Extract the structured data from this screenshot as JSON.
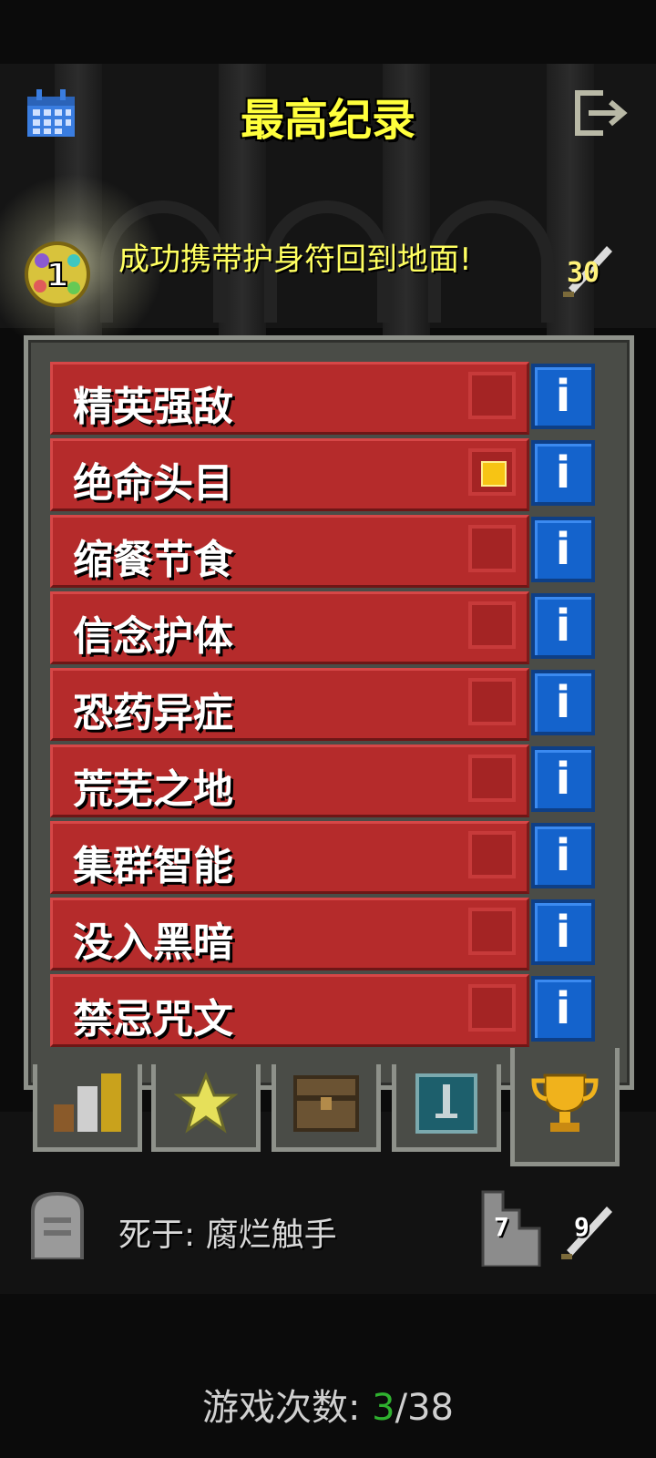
{
  "header": {
    "title": "最高纪录",
    "calendar_icon": "calendar-icon",
    "exit_icon": "exit-icon"
  },
  "top_record": {
    "rank": "1",
    "description": "成功携带护身符回到地面!",
    "depth": "30"
  },
  "challenges": [
    {
      "label": "精英强敌",
      "enabled": false
    },
    {
      "label": "绝命头目",
      "enabled": true
    },
    {
      "label": "缩餐节食",
      "enabled": false
    },
    {
      "label": "信念护体",
      "enabled": false
    },
    {
      "label": "恐药异症",
      "enabled": false
    },
    {
      "label": "荒芜之地",
      "enabled": false
    },
    {
      "label": "集群智能",
      "enabled": false
    },
    {
      "label": "没入黑暗",
      "enabled": false
    },
    {
      "label": "禁忌咒文",
      "enabled": false
    }
  ],
  "info_glyph": "i",
  "tabs": [
    {
      "icon": "stats-bars-icon",
      "active": false
    },
    {
      "icon": "star-icon",
      "active": false
    },
    {
      "icon": "chest-icon",
      "active": false
    },
    {
      "icon": "sword-card-icon",
      "active": false
    },
    {
      "icon": "trophy-icon",
      "active": true
    }
  ],
  "death_record": {
    "text": "死于:  腐烂触手",
    "depth": "7",
    "level": "9"
  },
  "games": {
    "label": "游戏次数:  ",
    "current": "3",
    "separator": "/",
    "total": "38"
  },
  "colors": {
    "title": "#ffff3c",
    "row_bg": "#b52b2b",
    "info_bg": "#1463cc",
    "check_on": "#f7c414",
    "games_current": "#2fb12f"
  }
}
